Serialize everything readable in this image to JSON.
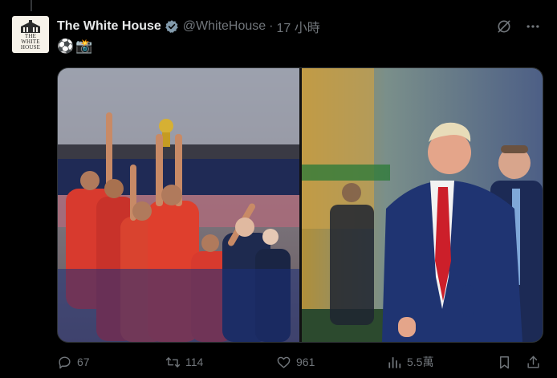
{
  "tweet": {
    "author_name": "The White House",
    "handle": "@WhiteHouse",
    "separator": "·",
    "timestamp": "17 小時",
    "avatar_text": [
      "THE",
      "WHITE",
      "HOUSE"
    ],
    "text_emojis": [
      "⚽",
      "📸"
    ],
    "verified_color": "#829aab",
    "images": [
      {
        "icon": "photo-soccer-team-celebration"
      },
      {
        "icon": "photo-man-in-suit-at-stadium"
      }
    ]
  },
  "actions": {
    "replies": "67",
    "retweets": "114",
    "likes": "961",
    "views": "5.5萬"
  },
  "colors": {
    "background": "#000000",
    "text_primary": "#e7e9ea",
    "text_secondary": "#71767b"
  }
}
